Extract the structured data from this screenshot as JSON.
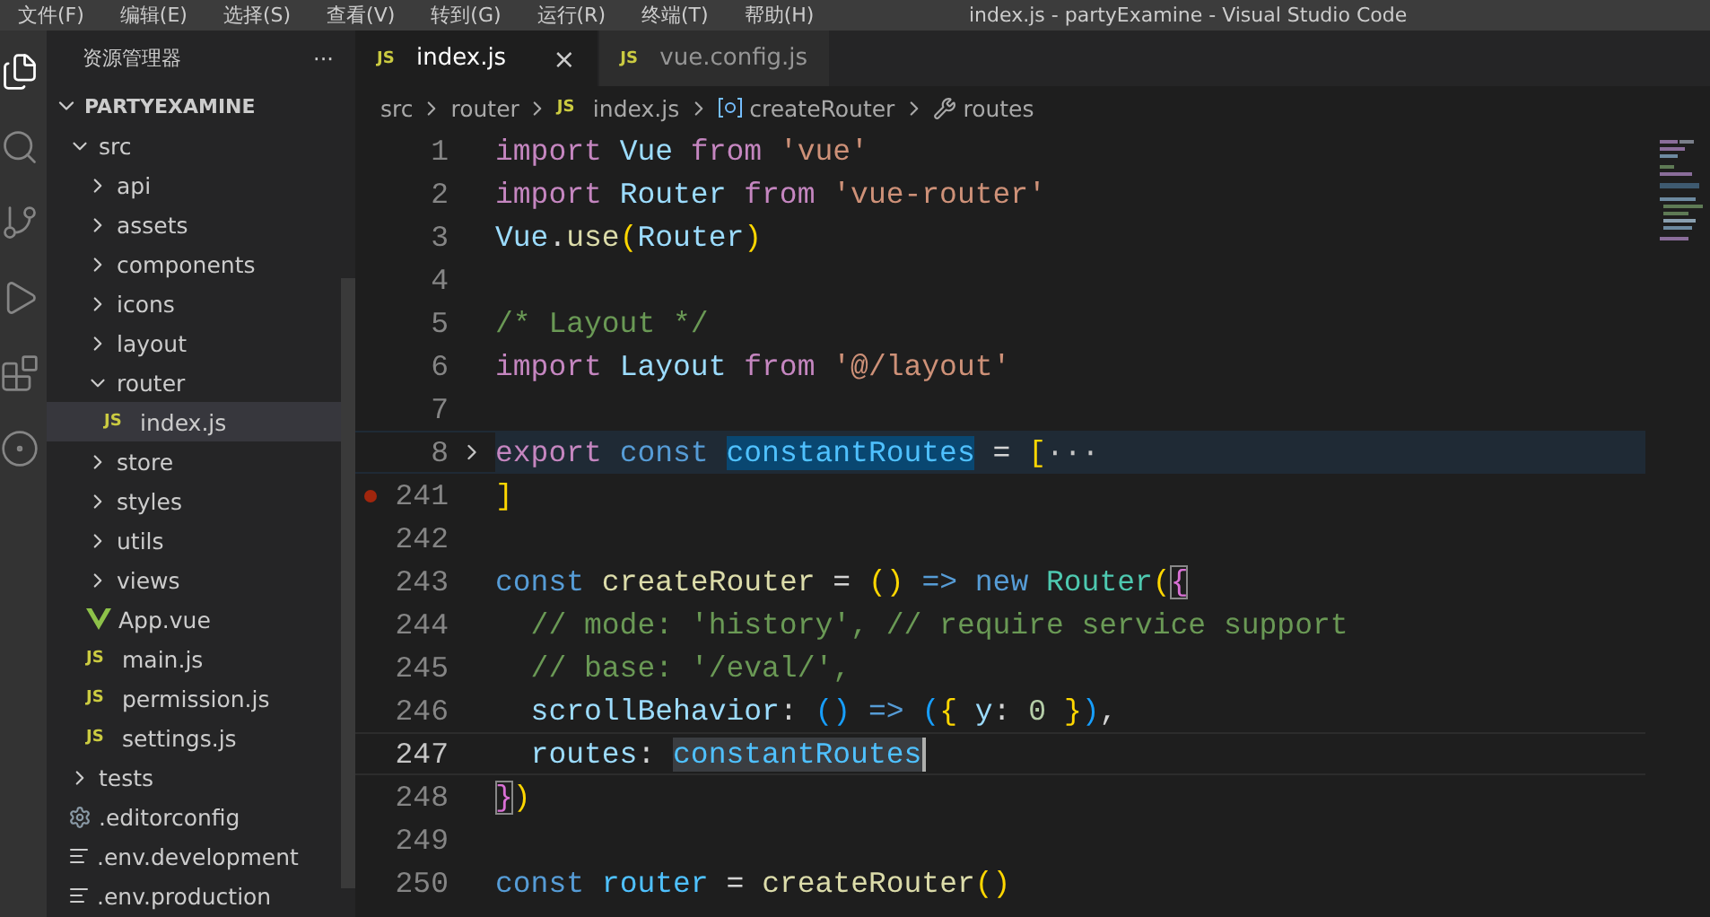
{
  "menu_bar": {
    "items": [
      "文件(F)",
      "编辑(E)",
      "选择(S)",
      "查看(V)",
      "转到(G)",
      "运行(R)",
      "终端(T)",
      "帮助(H)"
    ],
    "title": "index.js - partyExamine - Visual Studio Code"
  },
  "activity_bar": [
    {
      "kind": "files",
      "selected": true
    },
    {
      "kind": "search",
      "selected": false
    },
    {
      "kind": "scm",
      "selected": false
    },
    {
      "kind": "debug",
      "selected": false
    },
    {
      "kind": "extensions",
      "selected": false
    },
    {
      "kind": "remote",
      "selected": false
    }
  ],
  "explorer": {
    "title": "资源管理器",
    "more": "···",
    "root": {
      "label": "PARTYEXAMINE",
      "expanded": true
    },
    "tree": [
      {
        "label": "src",
        "kind": "folder",
        "expanded": true,
        "selected": false,
        "children": [
          {
            "label": "api",
            "kind": "folder",
            "expanded": false,
            "selected": false
          },
          {
            "label": "assets",
            "kind": "folder",
            "expanded": false,
            "selected": false
          },
          {
            "label": "components",
            "kind": "folder",
            "expanded": false,
            "selected": false
          },
          {
            "label": "icons",
            "kind": "folder",
            "expanded": false,
            "selected": false
          },
          {
            "label": "layout",
            "kind": "folder",
            "expanded": false,
            "selected": false
          },
          {
            "label": "router",
            "kind": "folder",
            "expanded": true,
            "selected": false,
            "children": [
              {
                "label": "index.js",
                "kind": "js",
                "badge": "JS",
                "selected": true
              }
            ]
          },
          {
            "label": "store",
            "kind": "folder",
            "expanded": false,
            "selected": false
          },
          {
            "label": "styles",
            "kind": "folder",
            "expanded": false,
            "selected": false
          },
          {
            "label": "utils",
            "kind": "folder",
            "expanded": false,
            "selected": false
          },
          {
            "label": "views",
            "kind": "folder",
            "expanded": false,
            "selected": false
          },
          {
            "label": "App.vue",
            "kind": "vue",
            "selected": false
          },
          {
            "label": "main.js",
            "kind": "js",
            "badge": "JS",
            "selected": false
          },
          {
            "label": "permission.js",
            "kind": "js",
            "badge": "JS",
            "selected": false
          },
          {
            "label": "settings.js",
            "kind": "js",
            "badge": "JS",
            "selected": false
          }
        ]
      },
      {
        "label": "tests",
        "kind": "folder",
        "expanded": false,
        "selected": false
      },
      {
        "label": ".editorconfig",
        "kind": "config",
        "selected": false
      },
      {
        "label": ".env.development",
        "kind": "text",
        "selected": false
      },
      {
        "label": ".env.production",
        "kind": "text",
        "selected": false
      }
    ]
  },
  "tabs": [
    {
      "label": "index.js",
      "badge": "JS",
      "selected": true,
      "close": "×"
    },
    {
      "label": "vue.config.js",
      "badge": "JS",
      "selected": false
    }
  ],
  "breadcrumbs": [
    {
      "label": "src",
      "kind": "folder"
    },
    {
      "label": "router",
      "kind": "folder"
    },
    {
      "label": "index.js",
      "kind": "js",
      "badge": "JS"
    },
    {
      "label": "createRouter",
      "kind": "variable"
    },
    {
      "label": "routes",
      "kind": "property"
    }
  ],
  "editor": {
    "lines": [
      {
        "number": "1",
        "folded": false,
        "breakpoint": false,
        "current": false,
        "tokens": [
          {
            "kind": "keyword",
            "text": "import "
          },
          {
            "kind": "variable",
            "text": "Vue "
          },
          {
            "kind": "keyword",
            "text": "from "
          },
          {
            "kind": "string",
            "text": "'vue'"
          }
        ]
      },
      {
        "number": "2",
        "folded": false,
        "breakpoint": false,
        "current": false,
        "tokens": [
          {
            "kind": "keyword",
            "text": "import "
          },
          {
            "kind": "variable",
            "text": "Router "
          },
          {
            "kind": "keyword",
            "text": "from "
          },
          {
            "kind": "string",
            "text": "'vue-router'"
          }
        ]
      },
      {
        "number": "3",
        "folded": false,
        "breakpoint": false,
        "current": false,
        "tokens": [
          {
            "kind": "variable",
            "text": "Vue"
          },
          {
            "kind": "plain",
            "text": "."
          },
          {
            "kind": "function",
            "text": "use"
          },
          {
            "kind": "bracket",
            "text": "("
          },
          {
            "kind": "variable",
            "text": "Router"
          },
          {
            "kind": "bracket",
            "text": ")"
          }
        ]
      },
      {
        "number": "4",
        "folded": false,
        "breakpoint": false,
        "current": false
      },
      {
        "number": "5",
        "folded": false,
        "breakpoint": false,
        "current": false,
        "tokens": [
          {
            "kind": "comment",
            "text": "/* Layout */"
          }
        ]
      },
      {
        "number": "6",
        "folded": false,
        "breakpoint": false,
        "current": false,
        "tokens": [
          {
            "kind": "keyword",
            "text": "import "
          },
          {
            "kind": "variable",
            "text": "Layout "
          },
          {
            "kind": "keyword",
            "text": "from "
          },
          {
            "kind": "string",
            "text": "'@/layout'"
          }
        ]
      },
      {
        "number": "7",
        "folded": false,
        "breakpoint": false,
        "current": false
      },
      {
        "number": "8",
        "folded": true,
        "breakpoint": false,
        "current": false,
        "tokens": [
          {
            "kind": "keyword",
            "text": "export "
          },
          {
            "kind": "storage",
            "text": "const "
          },
          {
            "kind": "occurrence",
            "text": "constantRoutes"
          },
          {
            "kind": "plain",
            "text": " = "
          },
          {
            "kind": "bracket",
            "text": "["
          },
          {
            "kind": "fold",
            "text": "···"
          }
        ]
      },
      {
        "number": "241",
        "folded": false,
        "breakpoint": true,
        "current": false,
        "tokens": [
          {
            "kind": "bracket",
            "text": "]"
          }
        ]
      },
      {
        "number": "242",
        "folded": false,
        "breakpoint": false,
        "current": false
      },
      {
        "number": "243",
        "folded": false,
        "breakpoint": false,
        "current": false,
        "tokens": [
          {
            "kind": "storage",
            "text": "const "
          },
          {
            "kind": "function",
            "text": "createRouter"
          },
          {
            "kind": "plain",
            "text": " = "
          },
          {
            "kind": "bracket",
            "text": "() "
          },
          {
            "kind": "storage",
            "text": "=> new "
          },
          {
            "kind": "class",
            "text": "Router"
          },
          {
            "kind": "bracket",
            "text": "("
          },
          {
            "kind": "match",
            "text": "{"
          }
        ]
      },
      {
        "number": "244",
        "folded": false,
        "breakpoint": false,
        "current": false,
        "tokens": [
          {
            "kind": "comment",
            "text": "  // mode: 'history', // require service support"
          }
        ]
      },
      {
        "number": "245",
        "folded": false,
        "breakpoint": false,
        "current": false,
        "tokens": [
          {
            "kind": "comment",
            "text": "  // base: '/eval/',"
          }
        ]
      },
      {
        "number": "246",
        "folded": false,
        "breakpoint": false,
        "current": false,
        "tokens": [
          {
            "kind": "variable",
            "text": "  scrollBehavior"
          },
          {
            "kind": "plain",
            "text": ": "
          },
          {
            "kind": "bracket3",
            "text": "() "
          },
          {
            "kind": "storage",
            "text": "=> "
          },
          {
            "kind": "bracket3",
            "text": "("
          },
          {
            "kind": "bracket",
            "text": "{ "
          },
          {
            "kind": "variable",
            "text": "y"
          },
          {
            "kind": "plain",
            "text": ": "
          },
          {
            "kind": "number",
            "text": "0 "
          },
          {
            "kind": "bracket",
            "text": "}"
          },
          {
            "kind": "bracket3",
            "text": ")"
          },
          {
            "kind": "plain",
            "text": ","
          }
        ]
      },
      {
        "number": "247",
        "folded": false,
        "breakpoint": false,
        "current": true,
        "tokens": [
          {
            "kind": "variable",
            "text": "  routes"
          },
          {
            "kind": "plain",
            "text": ": "
          },
          {
            "kind": "selection",
            "text": "constantRoutes"
          }
        ]
      },
      {
        "number": "248",
        "folded": false,
        "breakpoint": false,
        "current": false,
        "tokens": [
          {
            "kind": "match",
            "text": "}"
          },
          {
            "kind": "bracket",
            "text": ")"
          }
        ]
      },
      {
        "number": "249",
        "folded": false,
        "breakpoint": false,
        "current": false
      },
      {
        "number": "250",
        "folded": false,
        "breakpoint": false,
        "current": false,
        "tokens": [
          {
            "kind": "storage",
            "text": "const "
          },
          {
            "kind": "constant",
            "text": "router"
          },
          {
            "kind": "plain",
            "text": " = "
          },
          {
            "kind": "function",
            "text": "createRouter"
          },
          {
            "kind": "bracket",
            "text": "()"
          }
        ]
      }
    ]
  }
}
